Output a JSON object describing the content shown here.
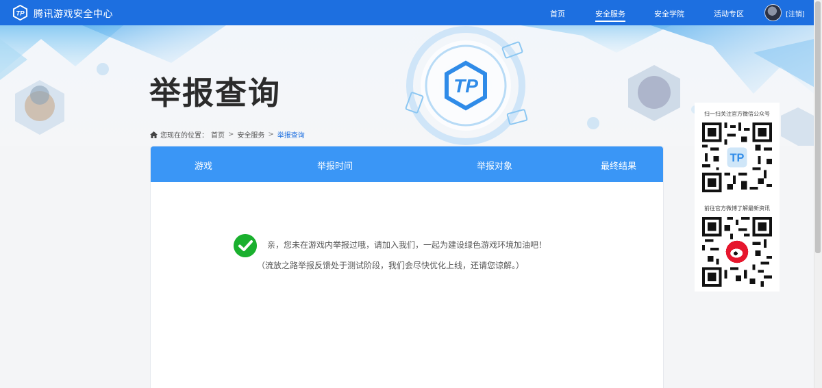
{
  "header": {
    "site_title": "腾讯游戏安全中心",
    "nav": [
      {
        "label": "首页",
        "active": false
      },
      {
        "label": "安全服务",
        "active": true
      },
      {
        "label": "安全学院",
        "active": false
      },
      {
        "label": "活动专区",
        "active": false
      }
    ],
    "logout_label": "[注销]"
  },
  "page": {
    "heading": "举报查询",
    "breadcrumb": {
      "prefix": "您现在的位置：",
      "items": [
        "首页",
        "安全服务",
        "举报查询"
      ],
      "separator": ">"
    }
  },
  "table": {
    "columns": [
      "游戏",
      "举报时间",
      "举报对象",
      "最终结果"
    ]
  },
  "empty_state": {
    "message": "亲，您未在游戏内举报过哦，请加入我们，一起为建设绿色游戏环境加油吧！",
    "note": "（流放之路举报反馈处于测试阶段，我们会尽快优化上线，还请您谅解。）"
  },
  "sidebar": {
    "wechat_caption": "扫一扫关注官方微信公众号",
    "weibo_caption": "前往官方微博了解最新资讯"
  },
  "colors": {
    "nav_blue": "#1d6fe0",
    "tab_blue": "#3a96f6",
    "success_green": "#1ab02e"
  },
  "icons": [
    "tp-logo-icon",
    "home-icon",
    "check-circle-icon",
    "wechat-qr-icon",
    "weibo-qr-icon",
    "avatar"
  ]
}
